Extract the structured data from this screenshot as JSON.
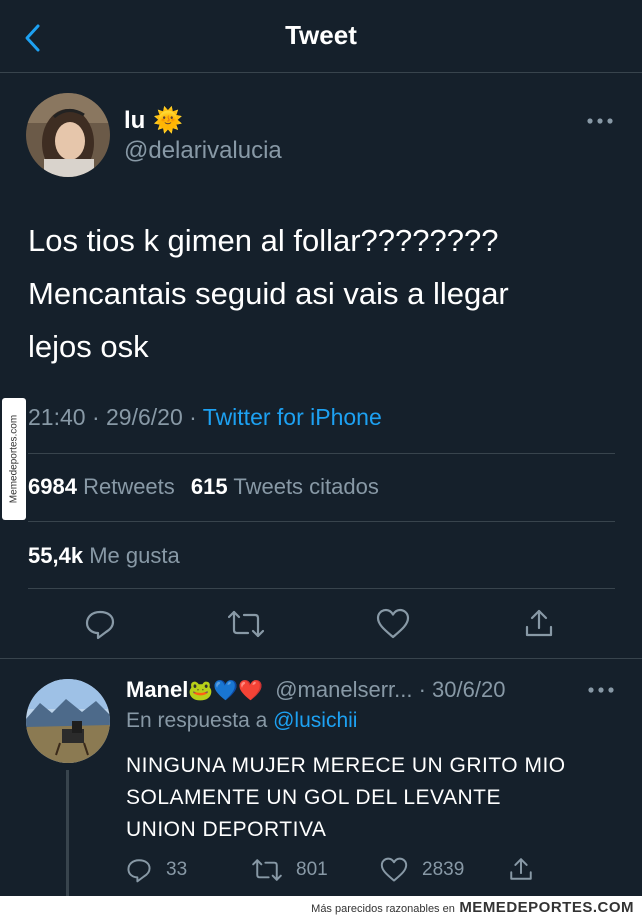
{
  "header": {
    "title": "Tweet"
  },
  "tweet": {
    "name": "lu",
    "name_emoji": "🌞",
    "handle": "@delarivalucia",
    "text_lines": [
      "Los tios k gimen al follar????????",
      "Mencantais seguid asi vais a llegar",
      "lejos osk"
    ],
    "time": "21:40",
    "date": "29/6/20",
    "source": "Twitter for iPhone",
    "retweets_count": "6984",
    "retweets_label": "Retweets",
    "quotes_count": "615",
    "quotes_label": "Tweets citados",
    "likes_count": "55,4k",
    "likes_label": "Me gusta"
  },
  "reply": {
    "name": "Manel",
    "name_emojis": "🐸💙❤️",
    "handle": "@manelserr...",
    "date": "· 30/6/20",
    "in_reply_prefix": "En respuesta a",
    "in_reply_handle": "@lusichii",
    "text_lines": [
      "NINGUNA MUJER MERECE UN GRITO MIO",
      "SOLAMENTE UN GOL DEL LEVANTE",
      "UNION DEPORTIVA"
    ],
    "reply_count": "33",
    "retweet_count": "801",
    "like_count": "2839"
  },
  "watermark": {
    "side": "Memedeportes.com",
    "bottom_small": "Más parecidos razonables en",
    "bottom_brand": "MEMEDEPORTES.COM"
  },
  "colors": {
    "background": "#15202b",
    "accent": "#1da1f2",
    "muted": "#8899a6",
    "divider": "#38444d"
  }
}
